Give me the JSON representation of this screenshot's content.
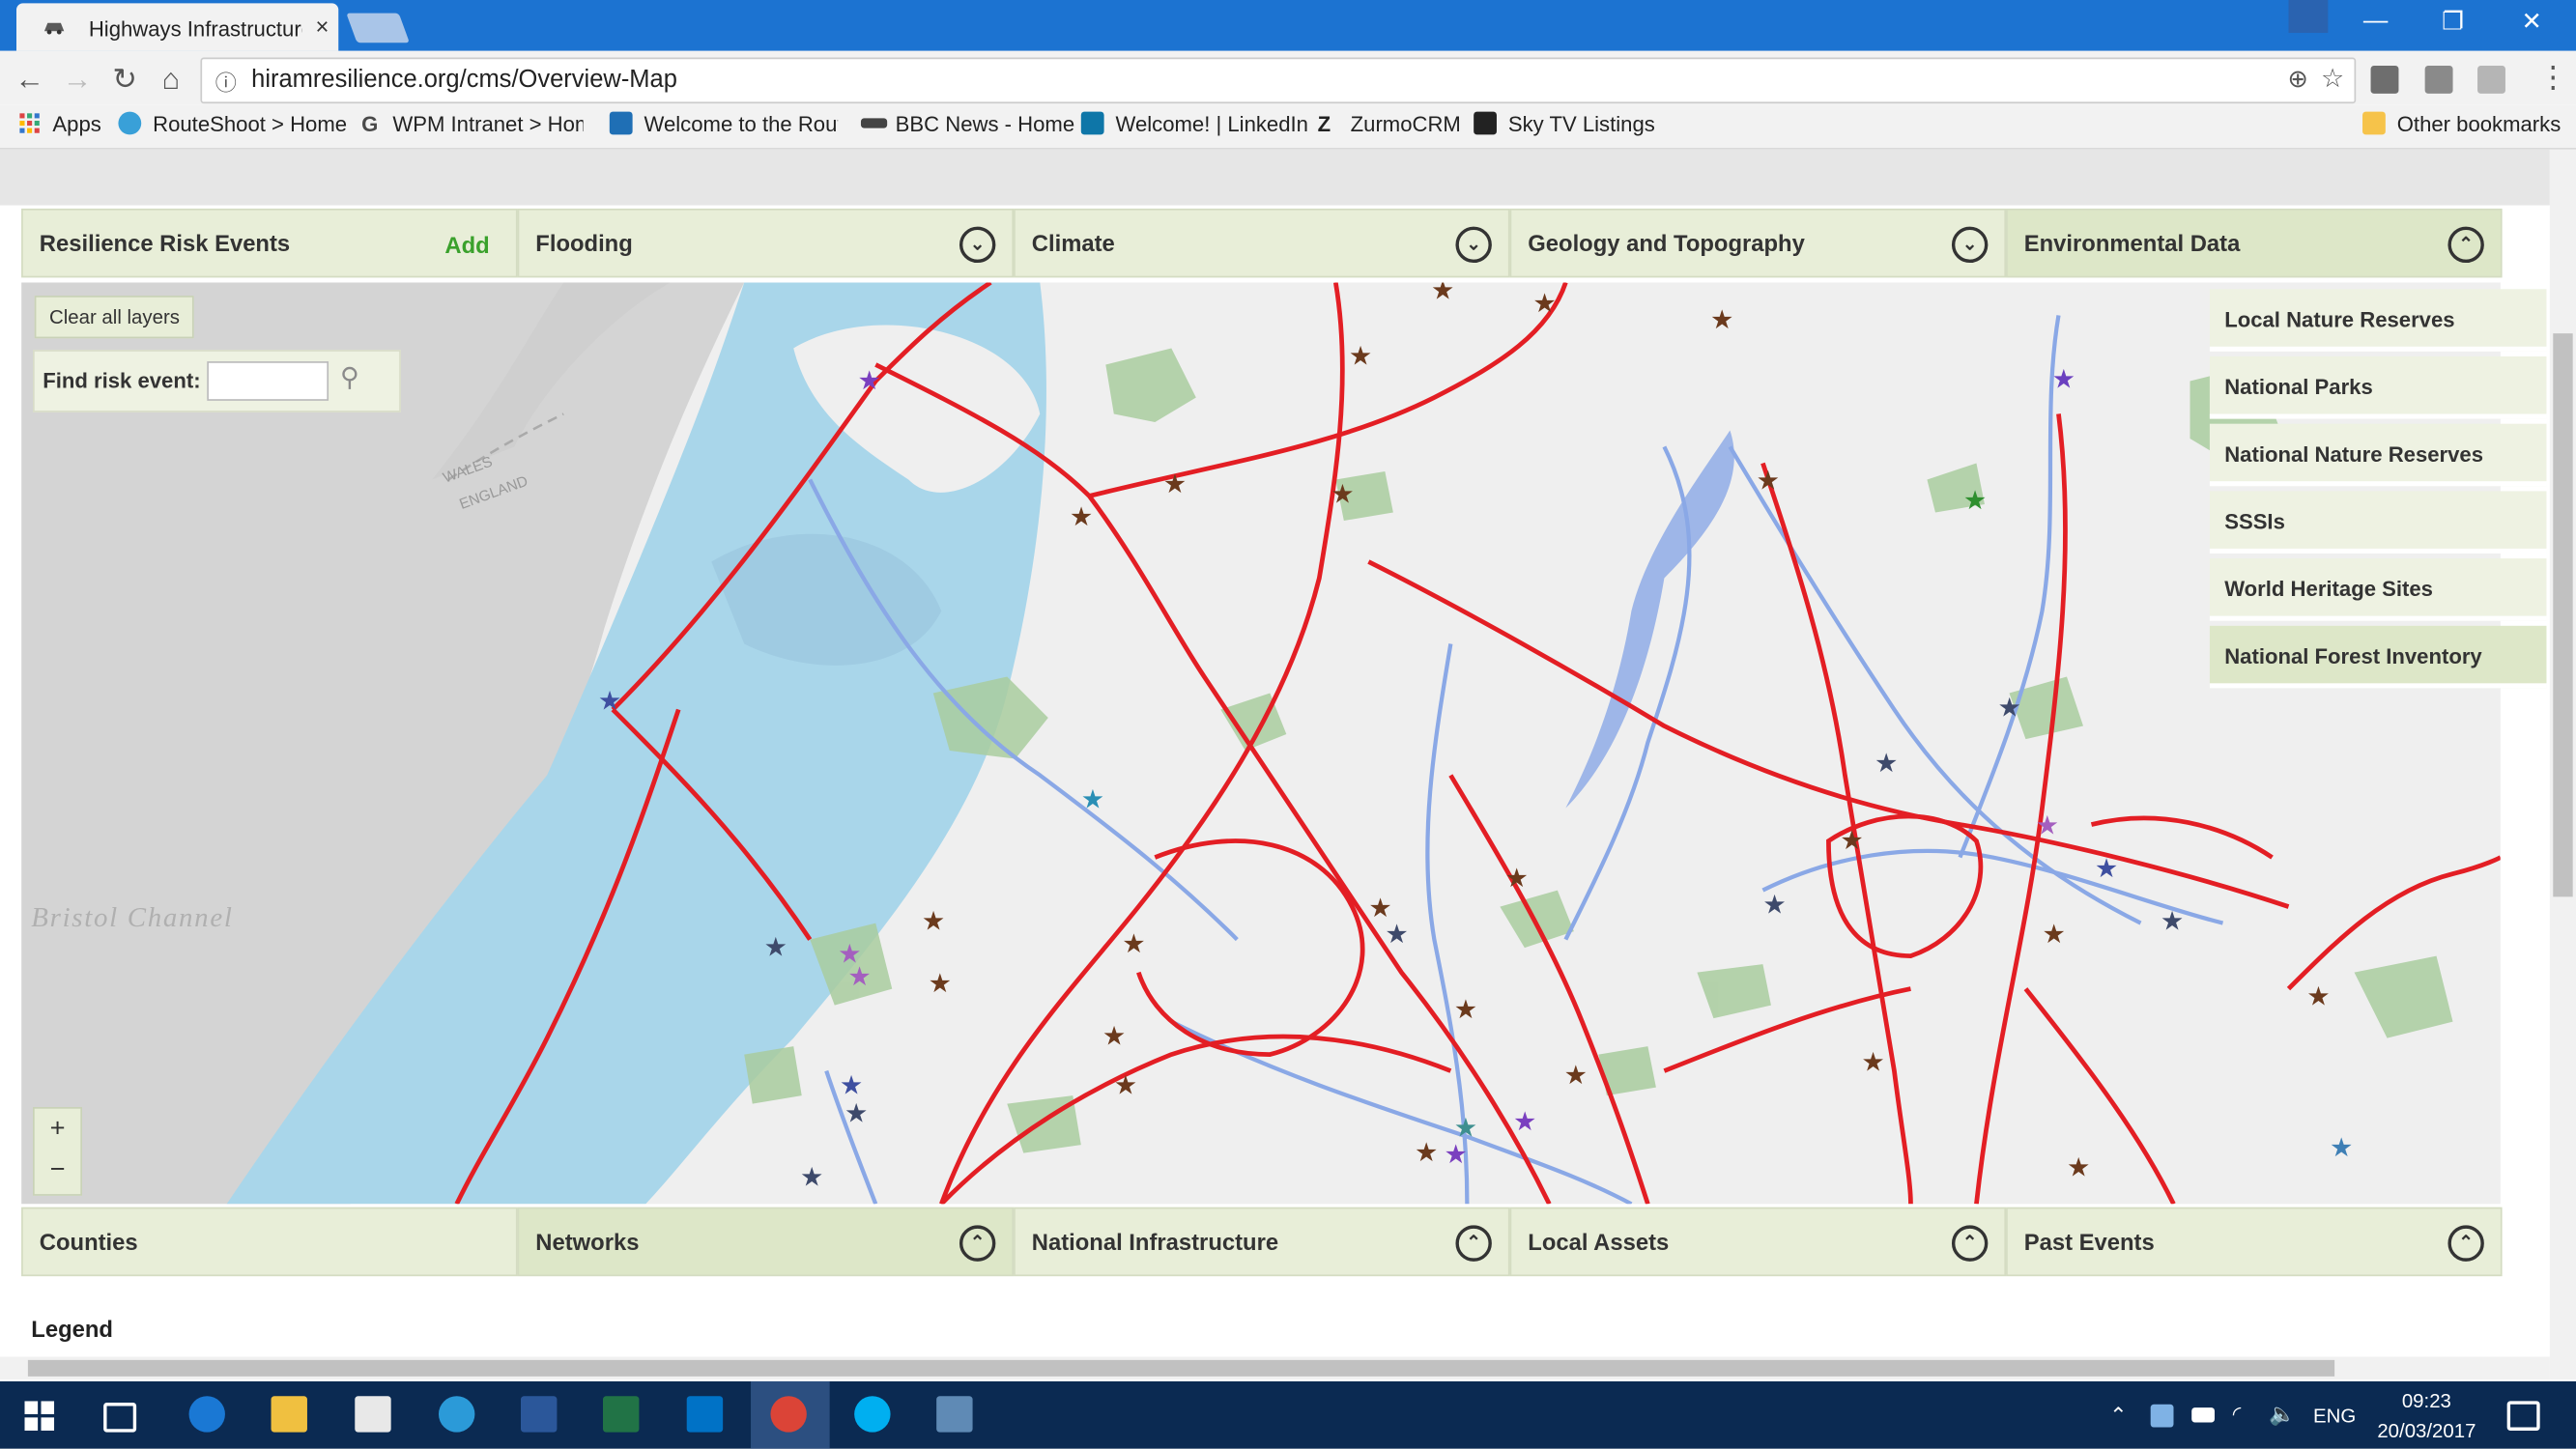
{
  "browser": {
    "tab_title": "Highways Infrastructure I",
    "tab_close": "×",
    "win_minimize": "—",
    "win_restore": "❐",
    "win_close": "✕",
    "url": "hiramresilience.org/cms/Overview-Map",
    "info_icon": "ⓘ",
    "zoom_icon": "⊕",
    "star_icon": "☆",
    "bookmarks": [
      {
        "label": "Apps",
        "icon": "apps-grid-icon"
      },
      {
        "label": "RouteShoot > Home",
        "icon": "routeshoot-icon"
      },
      {
        "label": "WPM Intranet > Hom",
        "icon": "google-icon"
      },
      {
        "label": "Welcome to the Rout",
        "icon": "globe-icon"
      },
      {
        "label": "BBC News - Home",
        "icon": "bbc-icon"
      },
      {
        "label": "Welcome! | LinkedIn",
        "icon": "linkedin-icon"
      },
      {
        "label": "ZurmoCRM",
        "icon": "zurmo-icon"
      },
      {
        "label": "Sky TV Listings",
        "icon": "sky-icon"
      }
    ],
    "other_bookmarks": "Other bookmarks"
  },
  "top_panels": [
    {
      "label": "Resilience Risk Events",
      "action": "Add"
    },
    {
      "label": "Flooding",
      "chevron": "⌄"
    },
    {
      "label": "Climate",
      "chevron": "⌄"
    },
    {
      "label": "Geology and Topography",
      "chevron": "⌄"
    },
    {
      "label": "Environmental Data",
      "chevron": "⌃"
    }
  ],
  "environmental_menu": [
    "Local Nature Reserves",
    "National Parks",
    "National Nature Reserves",
    "SSSIs",
    "World Heritage Sites",
    "National Forest Inventory"
  ],
  "map": {
    "clear_layers": "Clear all layers",
    "find_label": "Find risk event:",
    "find_value": "",
    "zoom_in": "+",
    "zoom_out": "−",
    "sea_label": "Bristol Channel",
    "border_label_1": "WALES",
    "border_label_2": "ENGLAND",
    "colors": {
      "sea": "#d4d4d4",
      "land": "#efefef",
      "flood_zone": "#a9d6ea",
      "rivers": "#8aa8e6",
      "roads": "#e31e24",
      "woodland": "#a9cc9f"
    }
  },
  "bottom_panels": [
    {
      "label": "Counties",
      "chevron": ""
    },
    {
      "label": "Networks",
      "chevron": "⌃"
    },
    {
      "label": "National Infrastructure",
      "chevron": "⌃"
    },
    {
      "label": "Local Assets",
      "chevron": "⌃"
    },
    {
      "label": "Past Events",
      "chevron": "⌃"
    }
  ],
  "legend_title": "Legend",
  "taskbar": {
    "language": "ENG",
    "time": "09:23",
    "date": "20/03/2017"
  }
}
